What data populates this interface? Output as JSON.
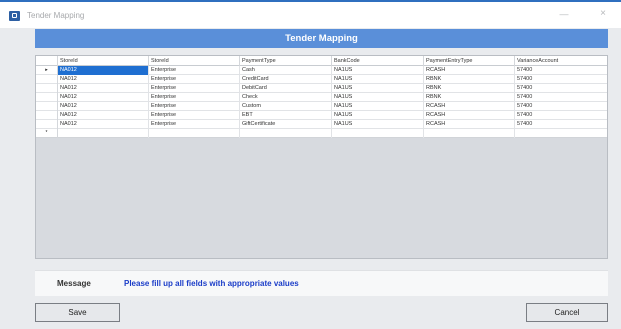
{
  "window": {
    "title": "Tender Mapping",
    "minimize_glyph": "—",
    "close_glyph": "×",
    "icon": "app-icon"
  },
  "header": {
    "title": "Tender Mapping"
  },
  "grid": {
    "columns": [
      "StoreId",
      "StoreId",
      "PaymentType",
      "BankCode",
      "PaymentEntryType",
      "VarianceAccount"
    ],
    "rows": [
      [
        "NA012",
        "Enterprise",
        "Cash",
        "NA1US",
        "RCASH",
        "57400"
      ],
      [
        "NA012",
        "Enterprise",
        "CreditCard",
        "NA1US",
        "RBNK",
        "57400"
      ],
      [
        "NA012",
        "Enterprise",
        "DebitCard",
        "NA1US",
        "RBNK",
        "57400"
      ],
      [
        "NA012",
        "Enterprise",
        "Check",
        "NA1US",
        "RBNK",
        "57400"
      ],
      [
        "NA012",
        "Enterprise",
        "Custom",
        "NA1US",
        "RCASH",
        "57400"
      ],
      [
        "NA012",
        "Enterprise",
        "EBT",
        "NA1US",
        "RCASH",
        "57400"
      ],
      [
        "NA012",
        "Enterprise",
        "GiftCertificate",
        "NA1US",
        "RCASH",
        "57400"
      ]
    ],
    "current_row_indicator": "▸",
    "new_row_indicator": "*"
  },
  "message": {
    "label": "Message",
    "text": "Please fill up all fields with appropriate values"
  },
  "buttons": {
    "save": "Save",
    "cancel": "Cancel"
  },
  "colors": {
    "header_band": "#5a8fd9",
    "selected_cell": "#1f6fd1",
    "message_text": "#1a3cc8"
  }
}
